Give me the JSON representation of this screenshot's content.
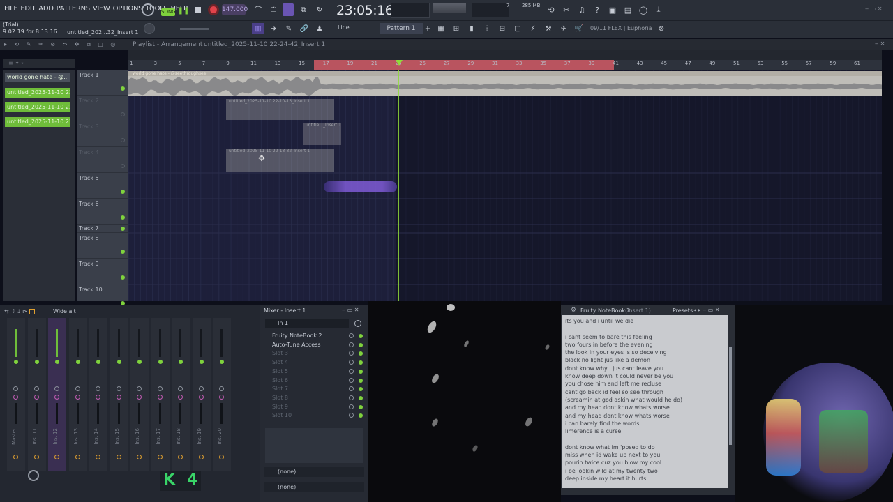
{
  "menu": [
    "FILE",
    "EDIT",
    "ADD",
    "PATTERNS",
    "VIEW",
    "OPTIONS",
    "TOOLS",
    "HELP"
  ],
  "transport": {
    "mode": "SONG",
    "tempo": "147.000",
    "time": "23:05:16",
    "memory": "285 MB",
    "cpu": "7",
    "cpu2": "1"
  },
  "trial": {
    "label": "(Trial)",
    "time": "9:02:19 for 8:13:16",
    "project": "untitled_202...32_Insert 1"
  },
  "toolbar2": {
    "snap": "Line",
    "pattern": "Pattern 1",
    "news": "09/11 FLEX | Euphoria"
  },
  "playlist": {
    "title": "Playlist - Arrangement",
    "project": "untitled_2025-11-10 22-24-42_Insert 1"
  },
  "ruler_ticks": [
    "1",
    "3",
    "5",
    "7",
    "9",
    "11",
    "13",
    "15",
    "17",
    "19",
    "21",
    "23",
    "25",
    "27",
    "29",
    "31",
    "33",
    "35",
    "37",
    "39",
    "41",
    "43",
    "45",
    "47",
    "49",
    "51",
    "53",
    "55",
    "57",
    "59",
    "61"
  ],
  "browser": {
    "items": [
      "world gone hate - @...",
      "untitled_2025-11-10 22-...",
      "untitled_2025-11-10 22-...",
      "untitled_2025-11-10 22-..."
    ]
  },
  "tracks": [
    "Track 1",
    "Track 2",
    "Track 3",
    "Track 4",
    "Track 5",
    "Track 6",
    "Track 7",
    "Track 8",
    "Track 9",
    "Track 10"
  ],
  "clips": {
    "c1": "world gone hate - @seethroughsee",
    "c2": "untitled_2025-11-10 22-10-13_Insert 1",
    "c3": "untitle..._Insert 1",
    "c4": "untitled_2025-11-10 22-13-32_Insert 1"
  },
  "mixer": {
    "view": "Wide alt",
    "title": "Mixer - Insert 1",
    "input": "In 1",
    "slots": [
      "Fruity NoteBook 2",
      "Auto-Tune Access",
      "Slot 3",
      "Slot 4",
      "Slot 5",
      "Slot 6",
      "Slot 7",
      "Slot 8",
      "Slot 9",
      "Slot 10"
    ],
    "out1": "(none)",
    "out2": "(none)",
    "strips": [
      "Master",
      "Ins. 11",
      "Ins. 12",
      "Ins. 13",
      "Ins. 14",
      "Ins. 15",
      "Ins. 16",
      "Ins. 17",
      "Ins. 18",
      "Ins. 19",
      "Ins. 20"
    ],
    "badge": "4"
  },
  "notebook": {
    "title": "Fruity NoteBook 2",
    "insert": "(Insert 1)",
    "presets": "Presets",
    "text": "its you and i until we die\n\ni cant seem to bare this feeling\ntwo fours in before the evening\nthe look in your eyes is so deceiving\nblack no light jus like a demon\ndont know why i jus cant leave you\nknow deep down it could never be you\nyou chose him and left me recluse\ncant go back id feel so see through\n(screamin at god askin what would he do)\nand my head dont know whats worse\nand my head dont know whats worse\ni can barely find the words\nlimerence is a curse\n\ndont know what im 'posed to do\nmiss when id wake up next to you\npourin twice cuz you blow my cool\ni be lookin wild at my twenty two\ndeep inside my heart it hurts"
  },
  "colors": {
    "accent": "#7fd23d",
    "loop": "#b9545f",
    "playhead": "#8fdc3a",
    "clipgray": "#bfbdb8",
    "clippurple": "#7f5bd6"
  }
}
